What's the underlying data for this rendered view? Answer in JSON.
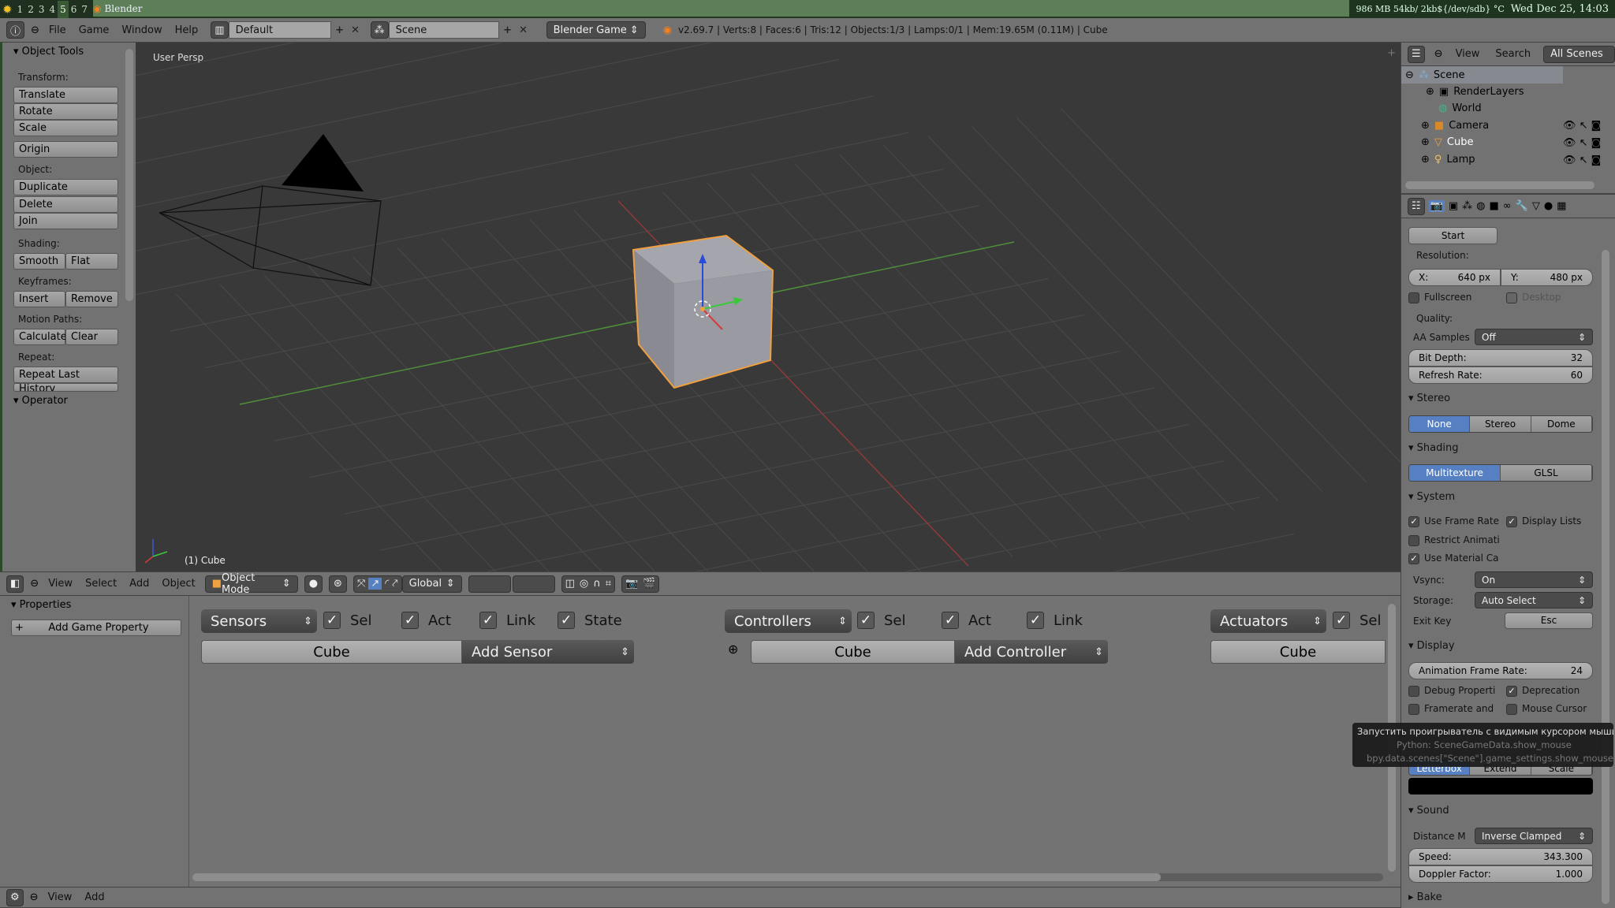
{
  "taskbar": {
    "workspaces": [
      "1",
      "2",
      "3",
      "4",
      "5",
      "6",
      "7"
    ],
    "active_workspace": "5",
    "window_title": "Blender",
    "status": "986 MB 54kb/ 2kb${/dev/sdb} °C",
    "clock": "Wed Dec 25, 14:03"
  },
  "info_header": {
    "menus": [
      "File",
      "Game",
      "Window",
      "Help"
    ],
    "layout": "Default",
    "scene": "Scene",
    "engine": "Blender Game",
    "stats": "v2.69.7 | Verts:8 | Faces:6 | Tris:12 | Objects:1/3 | Lamps:0/1 | Mem:19.65M (0.11M) | Cube"
  },
  "tools": {
    "title": "Object Tools",
    "transform_label": "Transform:",
    "translate": "Translate",
    "rotate": "Rotate",
    "scale": "Scale",
    "origin": "Origin",
    "object_label": "Object:",
    "duplicate": "Duplicate",
    "delete": "Delete",
    "join": "Join",
    "shading_label": "Shading:",
    "smooth": "Smooth",
    "flat": "Flat",
    "keyframes_label": "Keyframes:",
    "insert": "Insert",
    "remove": "Remove",
    "motion_label": "Motion Paths:",
    "calculate": "Calculate",
    "clear": "Clear",
    "repeat_label": "Repeat:",
    "repeat_last": "Repeat Last",
    "history": "History",
    "operator": "Operator"
  },
  "viewport": {
    "view_name": "User Persp",
    "object_label": "(1) Cube"
  },
  "view3d_header": {
    "menus": [
      "View",
      "Select",
      "Add",
      "Object"
    ],
    "mode": "Object Mode",
    "orientation": "Global"
  },
  "logic": {
    "properties_title": "Properties",
    "add_property": "Add Game Property",
    "sensors": {
      "label": "Sensors",
      "sel": "Sel",
      "act": "Act",
      "link": "Link",
      "state": "State",
      "object": "Cube",
      "add": "Add Sensor"
    },
    "controllers": {
      "label": "Controllers",
      "sel": "Sel",
      "act": "Act",
      "link": "Link",
      "object": "Cube",
      "add": "Add Controller"
    },
    "actuators": {
      "label": "Actuators",
      "sel": "Sel",
      "object": "Cube"
    }
  },
  "bottom_header": {
    "menus": [
      "View",
      "Add"
    ]
  },
  "outliner": {
    "menus": [
      "View",
      "Search"
    ],
    "filter": "All Scenes",
    "items": [
      "Scene",
      "RenderLayers",
      "World",
      "Camera",
      "Cube",
      "Lamp"
    ]
  },
  "props": {
    "start": "Start",
    "resolution": "Resolution:",
    "res_x_label": "X:",
    "res_x": "640 px",
    "res_y_label": "Y:",
    "res_y": "480 px",
    "fullscreen": "Fullscreen",
    "desktop": "Desktop",
    "quality": "Quality:",
    "aa_label": "AA Samples",
    "aa_value": "Off",
    "bit_depth_label": "Bit Depth:",
    "bit_depth": "32",
    "refresh_label": "Refresh Rate:",
    "refresh": "60",
    "stereo": "Stereo",
    "stereo_opts": [
      "None",
      "Stereo",
      "Dome"
    ],
    "shading": "Shading",
    "shading_opts": [
      "Multitexture",
      "GLSL"
    ],
    "system": "System",
    "use_frame_rate": "Use Frame Rate",
    "display_lists": "Display Lists",
    "restrict": "Restrict Animati",
    "use_material": "Use Material Ca",
    "vsync_label": "Vsync:",
    "vsync": "On",
    "storage_label": "Storage:",
    "storage": "Auto Select",
    "exit_key_label": "Exit Key",
    "exit_key": "Esc",
    "display": "Display",
    "anim_rate_label": "Animation Frame Rate:",
    "anim_rate": "24",
    "debug": "Debug Properti",
    "deprecation": "Deprecation",
    "framerate": "Framerate and",
    "mouse_cursor": "Mouse Cursor",
    "framing_opts": [
      "Letterbox",
      "Extend",
      "Scale"
    ],
    "sound": "Sound",
    "distance_label": "Distance M",
    "distance": "Inverse Clamped",
    "speed_label": "Speed:",
    "speed": "343.300",
    "doppler_label": "Doppler Factor:",
    "doppler": "1.000",
    "bake": "Bake"
  },
  "tooltip": {
    "line1": "Запустить проигрыватель с видимым курсором мыши",
    "line2": "Python: SceneGameData.show_mouse",
    "line3": "bpy.data.scenes[\"Scene\"].game_settings.show_mouse"
  },
  "colors": {
    "accent": "#5680c2",
    "selection": "#f0a040",
    "taskbar": "#5c7f57"
  }
}
